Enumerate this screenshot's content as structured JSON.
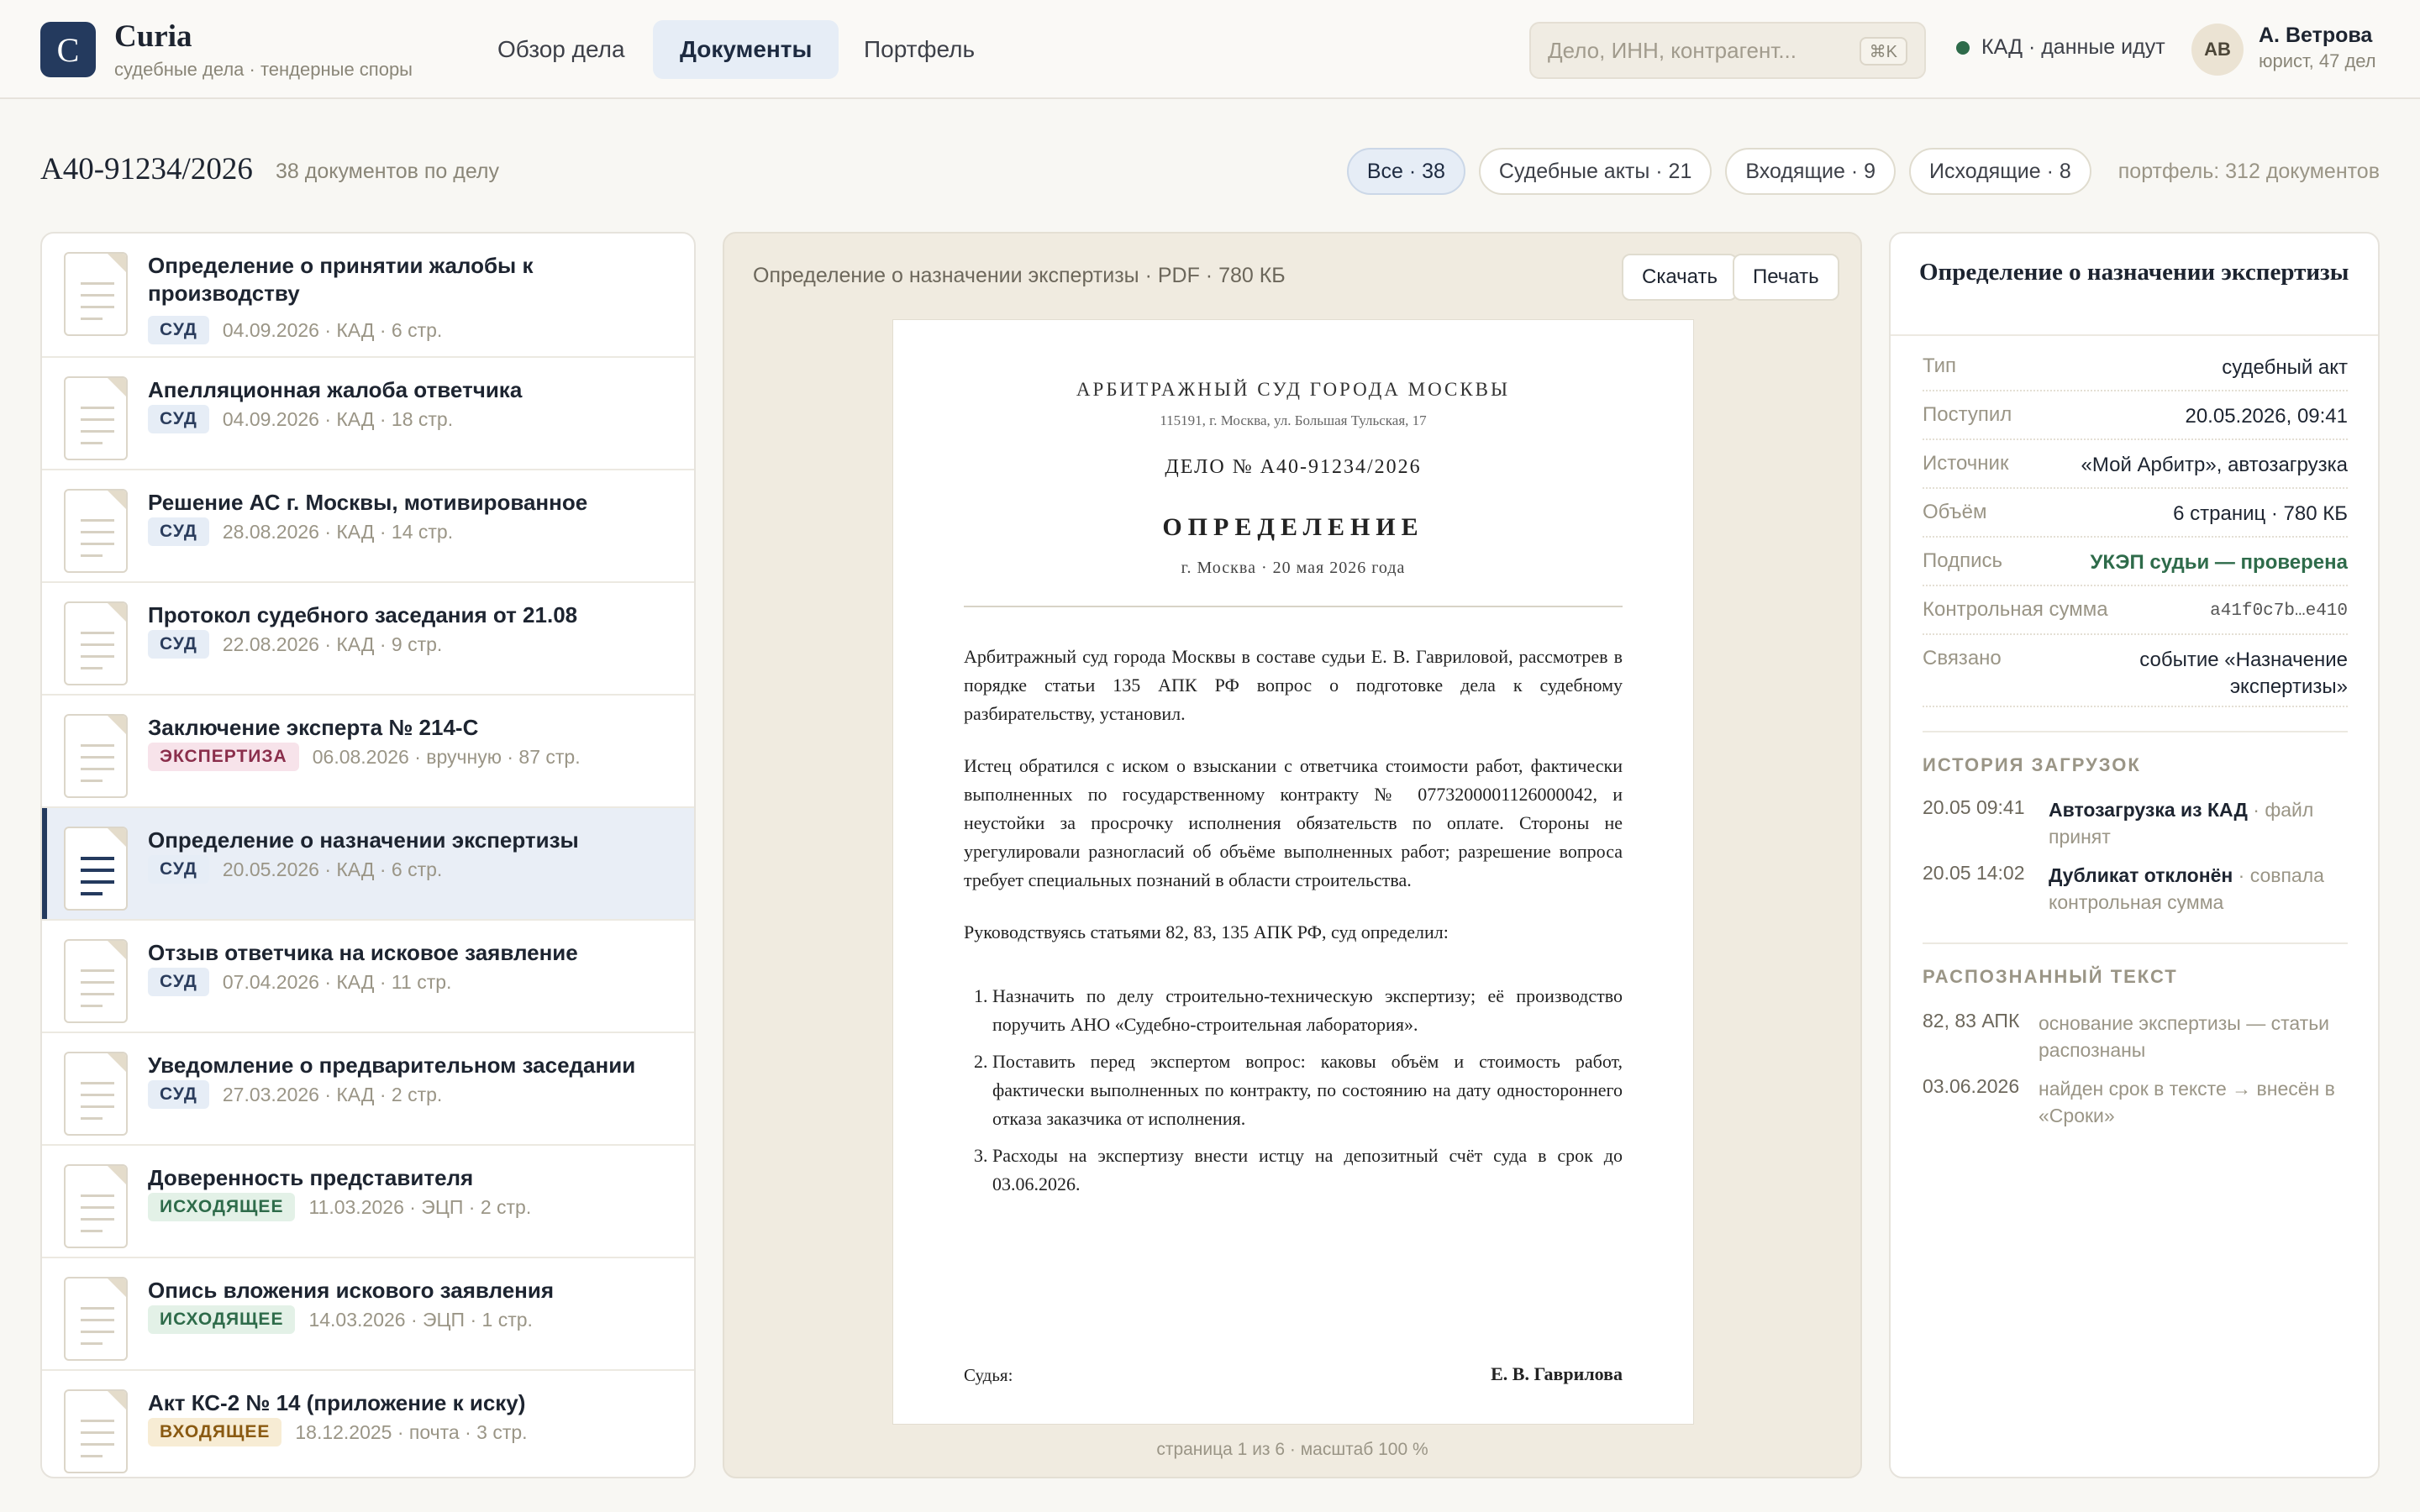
{
  "app": {
    "logo_letter": "C",
    "title": "Curia",
    "subtitle": "судебные дела · тендерные споры"
  },
  "nav": {
    "tabs": [
      {
        "label": "Обзор дела"
      },
      {
        "label": "Документы"
      },
      {
        "label": "Портфель"
      }
    ]
  },
  "search": {
    "placeholder": "Дело, ИНН, контрагент...",
    "shortcut": "⌘K"
  },
  "status": {
    "text": "КАД · данные идут",
    "color": "#2e6b4a"
  },
  "user": {
    "initials": "АВ",
    "name": "А. Ветрова",
    "role": "юрист, 47 дел"
  },
  "case": {
    "number": "А40-91234/2026",
    "doc_count": "38 документов по делу"
  },
  "filters": [
    {
      "label": "Все · 38"
    },
    {
      "label": "Судебные акты · 21"
    },
    {
      "label": "Входящие · 9"
    },
    {
      "label": "Исходящие · 8"
    }
  ],
  "portfolio_note": "портфель: 312 документов",
  "documents": [
    {
      "title": "Определение о принятии жалобы к производству",
      "tag": "СУД",
      "meta": "04.09.2026 · КАД · 6 стр."
    },
    {
      "title": "Апелляционная жалоба ответчика",
      "tag": "СУД",
      "meta": "04.09.2026 · КАД · 18 стр."
    },
    {
      "title": "Решение АС г. Москвы, мотивированное",
      "tag": "СУД",
      "meta": "28.08.2026 · КАД · 14 стр."
    },
    {
      "title": "Протокол судебного заседания от 21.08",
      "tag": "СУД",
      "meta": "22.08.2026 · КАД · 9 стр."
    },
    {
      "title": "Заключение эксперта № 214-С",
      "tag": "ЭКСПЕРТИЗА",
      "meta": "06.08.2026 · вручную · 87 стр."
    },
    {
      "title": "Определение о назначении экспертизы",
      "tag": "СУД",
      "meta": "20.05.2026 · КАД · 6 стр."
    },
    {
      "title": "Отзыв ответчика на исковое заявление",
      "tag": "СУД",
      "meta": "07.04.2026 · КАД · 11 стр."
    },
    {
      "title": "Уведомление о предварительном заседании",
      "tag": "СУД",
      "meta": "27.03.2026 · КАД · 2 стр."
    },
    {
      "title": "Доверенность представителя",
      "tag": "ИСХОДЯЩЕЕ",
      "meta": "11.03.2026 · ЭЦП · 2 стр."
    },
    {
      "title": "Опись вложения искового заявления",
      "tag": "ИСХОДЯЩЕЕ",
      "meta": "14.03.2026 · ЭЦП · 1 стр."
    },
    {
      "title": "Акт КС-2 № 14 (приложение к иску)",
      "tag": "ВХОДЯЩЕЕ",
      "meta": "18.12.2025 · почта · 3 стр."
    }
  ],
  "viewer": {
    "caption": "Определение о назначении экспертизы · PDF · 780 КБ",
    "download_label": "Скачать",
    "print_label": "Печать",
    "footer": "страница 1 из 6 · масштаб 100 %",
    "page": {
      "court": "АРБИТРАЖНЫЙ СУД ГОРОДА МОСКВЫ",
      "address": "115191, г. Москва, ул. Большая Тульская, 17",
      "case_line": "ДЕЛО № А40-91234/2026",
      "heading": "ОПРЕДЕЛЕНИЕ",
      "place_date": "г. Москва · 20 мая 2026 года",
      "para1": "Арбитражный суд города Москвы в составе судьи Е. В. Гавриловой, рассмотрев в порядке статьи 135 АПК РФ вопрос о подготовке дела к судебному разбирательству, установил.",
      "para2": "Истец обратился с иском о взыскании с ответчика стоимости работ, фактически выполненных по государственному контракту № 0773200001126000042, и неустойки за просрочку исполнения обязательств по оплате. Стороны не урегулировали разногласий об объёме выполненных работ; разрешение вопроса требует специальных познаний в области строительства.",
      "para3": "Руководствуясь статьями 82, 83, 135 АПК РФ, суд определил:",
      "items": [
        "Назначить по делу строительно-техническую экспертизу; её производство поручить АНО «Судебно-строительная лаборатория».",
        "Поставить перед экспертом вопрос: каковы объём и стоимость работ, фактически выполненных по контракту, по состоянию на дату одностороннего отказа заказчика от исполнения.",
        "Расходы на экспертизу внести истцу на депозитный счёт суда в срок до 03.06.2026."
      ],
      "judge_label": "Судья:",
      "judge_name": "Е. В. Гаврилова"
    }
  },
  "details": {
    "title": "Определение о назначении экспертизы",
    "props": [
      {
        "label": "Тип",
        "value": "судебный акт"
      },
      {
        "label": "Поступил",
        "value": "20.05.2026, 09:41"
      },
      {
        "label": "Источник",
        "value": "«Мой Арбитр», автозагрузка"
      },
      {
        "label": "Объём",
        "value": "6 страниц · 780 КБ"
      },
      {
        "label": "Подпись",
        "value": "УКЭП судьи — проверена"
      },
      {
        "label": "Контрольная сумма",
        "value": "a41f0c7b…e410"
      },
      {
        "label": "Связано",
        "value": "событие «Назначение экспертизы»"
      }
    ],
    "history_title": "ИСТОРИЯ ЗАГРУЗОК",
    "history": [
      {
        "time": "20.05 09:41",
        "action": "Автозагрузка из КАД",
        "note": "· файл принят"
      },
      {
        "time": "20.05 14:02",
        "action": "Дубликат отклонён",
        "note": "· совпала контрольная сумма"
      }
    ],
    "ocr_title": "РАСПОЗНАННЫЙ ТЕКСТ",
    "ocr": [
      {
        "key": "82, 83 АПК",
        "text": "основание экспертизы — статьи распознаны"
      },
      {
        "key": "03.06.2026",
        "text": "найден срок в тексте → внесён в «Сроки»"
      }
    ]
  },
  "colors": {
    "brand": "#243a5e",
    "selected_bg": "#e9eef6",
    "signature_ok": "#2e6b4a"
  }
}
